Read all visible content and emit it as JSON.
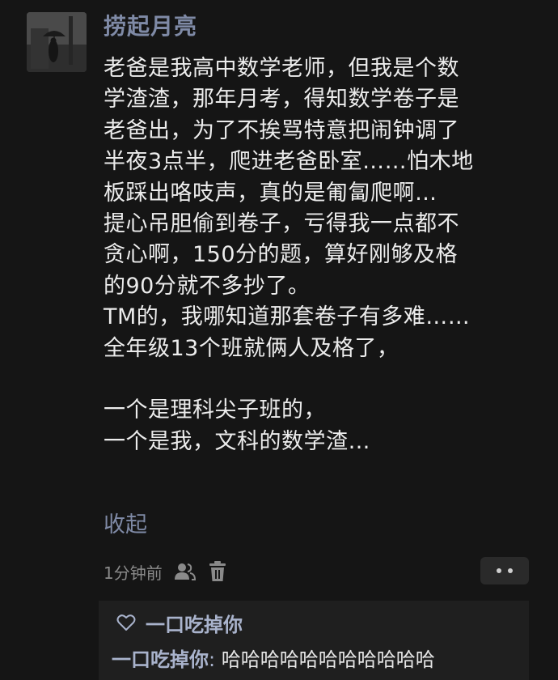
{
  "post": {
    "username": "捞起月亮",
    "avatar_icon": "avatar-person-umbrella",
    "content_lines": [
      "老爸是我高中数学老师，但我是个数",
      "学渣渣，那年月考，得知数学卷子是",
      "老爸出，为了不挨骂特意把闹钟调了",
      "半夜3点半，爬进老爸卧室……怕木地",
      "板踩出咯吱声，真的是匍匐爬啊…",
      "提心吊胆偷到卷子，亏得我一点都不",
      "贪心啊，150分的题，算好刚够及格",
      "的90分就不多抄了。",
      "TM的，我哪知道那套卷子有多难……",
      "全年级13个班就俩人及格了，",
      "",
      "一个是理科尖子班的，",
      "一个是我，文科的数学渣…"
    ],
    "collapse_label": "收起",
    "time": "1分钟前",
    "visibility_icon": "friends-icon",
    "delete_icon": "trash-icon",
    "more_icon": "more-dots-icon"
  },
  "comments": {
    "like_icon": "heart-icon",
    "likers": "一口吃掉你",
    "items": [
      {
        "author": "一口吃掉你",
        "separator": ":",
        "text": " 哈哈哈哈哈哈哈哈哈哈哈"
      }
    ]
  },
  "colors": {
    "background": "#151515",
    "name_accent": "#7f8aa6",
    "comment_name": "#a9b3cc",
    "comment_bg": "#1f1f1f",
    "text": "#ececec",
    "meta": "#8a8a8a"
  }
}
